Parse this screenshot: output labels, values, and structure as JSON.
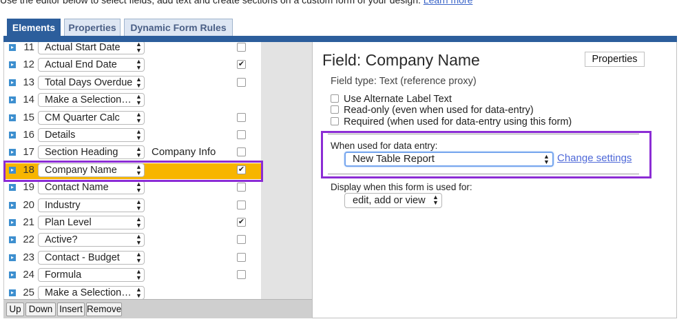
{
  "intro": {
    "text": "Use the editor below to select fields, add text and create sections on a custom form of your design.",
    "link": "Learn more"
  },
  "tabs": [
    {
      "label": "Elements",
      "active": true
    },
    {
      "label": "Properties",
      "active": false
    },
    {
      "label": "Dynamic Form Rules",
      "active": false
    }
  ],
  "rows": [
    {
      "num": "11",
      "field": "Actual Start Date",
      "extra": "",
      "checkbox": true,
      "checked": false,
      "selected": false
    },
    {
      "num": "12",
      "field": "Actual End Date",
      "extra": "",
      "checkbox": true,
      "checked": true,
      "selected": false
    },
    {
      "num": "13",
      "field": "Total Days Overdue",
      "extra": "",
      "checkbox": true,
      "checked": false,
      "selected": false
    },
    {
      "num": "14",
      "field": "Make a Selection…",
      "extra": "",
      "checkbox": false,
      "checked": false,
      "selected": false
    },
    {
      "num": "15",
      "field": "CM Quarter Calc",
      "extra": "",
      "checkbox": true,
      "checked": false,
      "selected": false
    },
    {
      "num": "16",
      "field": "Details",
      "extra": "",
      "checkbox": true,
      "checked": false,
      "selected": false
    },
    {
      "num": "17",
      "field": "Section Heading",
      "extra": "Company Info",
      "checkbox": true,
      "checked": false,
      "selected": false
    },
    {
      "num": "18",
      "field": "Company Name",
      "extra": "",
      "checkbox": true,
      "checked": true,
      "selected": true
    },
    {
      "num": "19",
      "field": "Contact Name",
      "extra": "",
      "checkbox": true,
      "checked": false,
      "selected": false
    },
    {
      "num": "20",
      "field": "Industry",
      "extra": "",
      "checkbox": true,
      "checked": false,
      "selected": false
    },
    {
      "num": "21",
      "field": "Plan Level",
      "extra": "",
      "checkbox": true,
      "checked": true,
      "selected": false
    },
    {
      "num": "22",
      "field": "Active?",
      "extra": "",
      "checkbox": true,
      "checked": false,
      "selected": false
    },
    {
      "num": "23",
      "field": "Contact - Budget",
      "extra": "",
      "checkbox": true,
      "checked": false,
      "selected": false
    },
    {
      "num": "24",
      "field": "Formula",
      "extra": "",
      "checkbox": true,
      "checked": false,
      "selected": false
    },
    {
      "num": "25",
      "field": "Make a Selection…",
      "extra": "",
      "checkbox": false,
      "checked": false,
      "selected": false
    }
  ],
  "bottom_buttons": [
    "Up",
    "Down",
    "Insert",
    "Remove"
  ],
  "details": {
    "title": "Field: Company Name",
    "properties_button": "Properties",
    "field_type": "Field type: Text (reference proxy)",
    "options": [
      {
        "label": "Use Alternate Label Text",
        "checked": false
      },
      {
        "label": "Read-only (even when used for data-entry)",
        "checked": false
      },
      {
        "label": "Required (when used for data-entry using this form)",
        "checked": false
      }
    ],
    "data_entry_label": "When used for data entry:",
    "data_entry_value": "New Table Report",
    "change_settings": "Change settings",
    "display_label": "Display when this form is used for:",
    "display_value": "edit, add or view"
  },
  "colors": {
    "tab_active": "#2c5e9c",
    "selected_row": "#f7b500",
    "annotation": "#8b2cd4",
    "link": "#4e68d8"
  }
}
